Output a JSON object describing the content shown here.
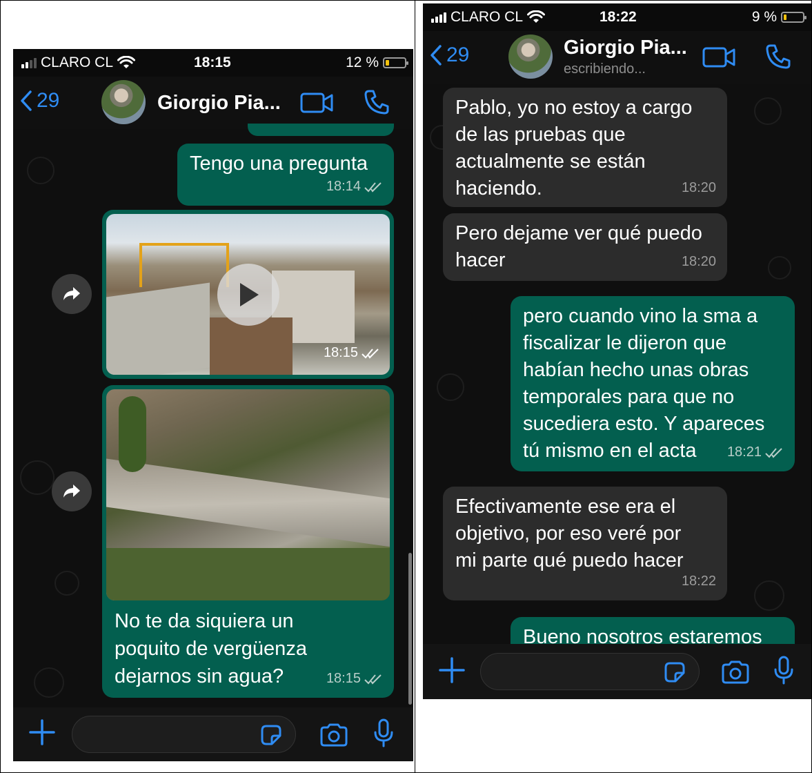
{
  "left": {
    "status": {
      "carrier": "CLARO CL",
      "time": "18:15",
      "battery": "12 %",
      "battery_level": 0.12
    },
    "header": {
      "back_count": "29",
      "contact_name": "Giorgio Pia..."
    },
    "messages": [
      {
        "kind": "text",
        "direction": "out",
        "text": "Tengo una pregunta",
        "time": "18:14"
      },
      {
        "kind": "video",
        "direction": "out",
        "time": "18:15"
      },
      {
        "kind": "image",
        "direction": "out",
        "caption": "No te da siquiera un poquito de vergüenza dejarnos sin agua?",
        "caption_lines": [
          "No te da siquiera un",
          "poquito de vergüenza",
          "dejarnos sin agua?"
        ],
        "time": "18:15"
      }
    ]
  },
  "right": {
    "status": {
      "carrier": "CLARO CL",
      "time": "18:22",
      "battery": "9 %",
      "battery_level": 0.09
    },
    "header": {
      "back_count": "29",
      "contact_name": "Giorgio Pia...",
      "typing": "escribiendo..."
    },
    "messages": [
      {
        "direction": "in",
        "lines": [
          "Pablo, yo no estoy a cargo",
          "de las pruebas que",
          "actualmente se están",
          "haciendo."
        ],
        "time": "18:20"
      },
      {
        "direction": "in",
        "lines": [
          "Pero dejame ver qué puedo",
          "hacer"
        ],
        "time": "18:20"
      },
      {
        "direction": "out",
        "lines": [
          "pero cuando vino la sma a",
          "fiscalizar le dijeron que",
          "habían hecho unas obras",
          "temporales para que no",
          "sucediera esto. Y apareces",
          "tú mismo en el acta"
        ],
        "time": "18:21"
      },
      {
        "direction": "in",
        "lines": [
          "Efectivamente ese era el",
          "objetivo, por eso veré por",
          "mi parte qué puedo hacer"
        ],
        "time": "18:22"
      },
      {
        "direction": "out",
        "lines": [
          "Bueno nosotros estaremos"
        ]
      }
    ]
  },
  "colors": {
    "outgoing": "#035f4f",
    "incoming": "#2c2c2c",
    "accent": "#2f8cf3",
    "background": "#0b0b0b"
  },
  "icons": [
    "chevron-left-icon",
    "video-call-icon",
    "phone-icon",
    "forward-icon",
    "play-icon",
    "double-check-icon",
    "plus-icon",
    "sticker-icon",
    "camera-icon",
    "microphone-icon",
    "wifi-icon",
    "signal-icon",
    "battery-icon"
  ]
}
